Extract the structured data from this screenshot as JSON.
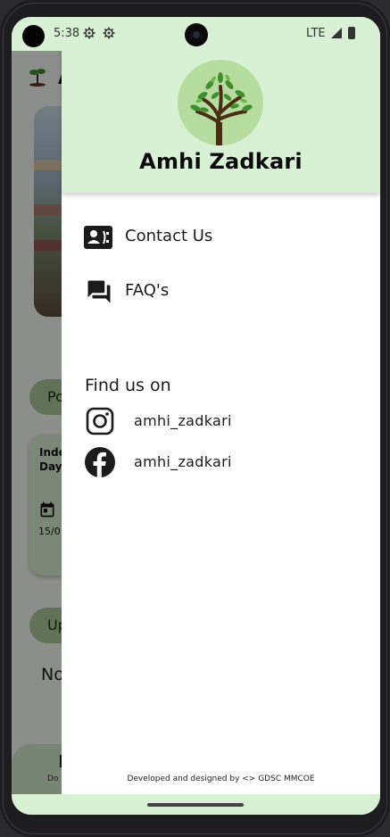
{
  "status_bar": {
    "time": "5:38",
    "network": "LTE",
    "icons": [
      "settings-icon",
      "settings-icon",
      "signal-icon",
      "battery-icon"
    ]
  },
  "background": {
    "chip_1": "Po",
    "card_title": "Inde\nDay",
    "card_date": "15/0",
    "chip_2": "Up",
    "no_text": "No",
    "bottom_label": "Do"
  },
  "drawer": {
    "header_title": "Amhi Zadkari",
    "menu": [
      {
        "label": "Contact Us",
        "icon": "contact-card-icon"
      },
      {
        "label": "FAQ's",
        "icon": "forum-icon"
      }
    ],
    "find_us_title": "Find us on",
    "social": [
      {
        "label": "amhi_zadkari",
        "icon": "instagram-icon"
      },
      {
        "label": "amhi_zadkari",
        "icon": "facebook-icon"
      }
    ],
    "footer": "Developed and designed by <> GDSC MMCOE"
  },
  "colors": {
    "header_bg": "#d8f0d3",
    "logo_circle": "#b7dca0",
    "text": "#1b1b1b"
  }
}
